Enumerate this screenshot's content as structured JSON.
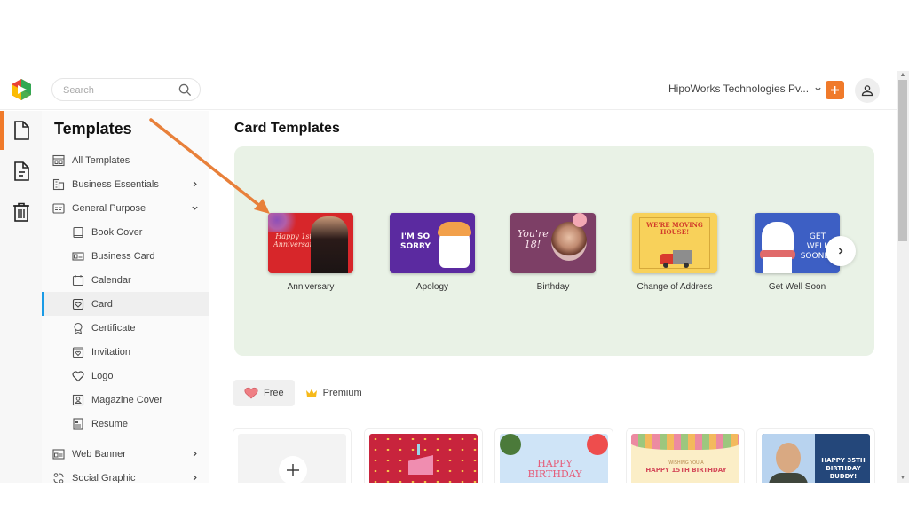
{
  "header": {
    "search_placeholder": "Search",
    "organization": "HipoWorks Technologies Pv...",
    "add_button_color": "#f07a2a"
  },
  "rail": {
    "items": [
      {
        "icon": "document-icon",
        "active": true
      },
      {
        "icon": "file-text-icon",
        "active": false
      },
      {
        "icon": "trash-icon",
        "active": false
      }
    ]
  },
  "sidebar": {
    "title": "Templates",
    "items": [
      {
        "label": "All Templates",
        "icon": "grid-icon",
        "level": 1
      },
      {
        "label": "Business Essentials",
        "icon": "building-icon",
        "level": 1,
        "expand": "right"
      },
      {
        "label": "General Purpose",
        "icon": "sign-icon",
        "level": 1,
        "expand": "down"
      },
      {
        "label": "Book Cover",
        "icon": "book-icon",
        "level": 2
      },
      {
        "label": "Business Card",
        "icon": "id-card-icon",
        "level": 2
      },
      {
        "label": "Calendar",
        "icon": "calendar-icon",
        "level": 2
      },
      {
        "label": "Card",
        "icon": "heart-card-icon",
        "level": 2,
        "active": true
      },
      {
        "label": "Certificate",
        "icon": "award-icon",
        "level": 2
      },
      {
        "label": "Invitation",
        "icon": "invitation-icon",
        "level": 2
      },
      {
        "label": "Logo",
        "icon": "heart-icon",
        "level": 2
      },
      {
        "label": "Magazine Cover",
        "icon": "magazine-icon",
        "level": 2
      },
      {
        "label": "Resume",
        "icon": "resume-icon",
        "level": 2
      },
      {
        "label": "Web Banner",
        "icon": "banner-icon",
        "level": 1,
        "expand": "right"
      },
      {
        "label": "Social Graphic",
        "icon": "social-icon",
        "level": 1,
        "expand": "right"
      }
    ]
  },
  "main": {
    "title": "Card Templates",
    "categories": [
      {
        "label": "Anniversary",
        "thumb_text": "Happy 1st Anniversary",
        "color": "#d7262a"
      },
      {
        "label": "Apology",
        "thumb_text": "I'M SO SORRY",
        "color": "#5b2aa0"
      },
      {
        "label": "Birthday",
        "thumb_text": "You're 18!",
        "color": "#7d3f66"
      },
      {
        "label": "Change of Address",
        "thumb_text": "WE'RE MOVING HOUSE!",
        "color": "#f8d15a"
      },
      {
        "label": "Get Well Soon",
        "thumb_text": "GET WELL SOONER",
        "color": "#3d5fc4"
      }
    ],
    "filters": [
      {
        "label": "Free",
        "icon": "heart-icon",
        "active": true
      },
      {
        "label": "Premium",
        "icon": "crown-icon",
        "active": false
      }
    ],
    "grid": [
      {
        "type": "new"
      },
      {
        "thumb_text": "",
        "color": "#c8243d"
      },
      {
        "thumb_text": "HAPPY BIRTHDAY",
        "color": "#cfe4f7"
      },
      {
        "thumb_text": "HAPPY 15TH BIRTHDAY",
        "subtext": "WISHING YOU A",
        "color": "#fbeec7"
      },
      {
        "thumb_text": "HAPPY 35TH BIRTHDAY BUDDY!",
        "color": "#24477a"
      }
    ]
  }
}
